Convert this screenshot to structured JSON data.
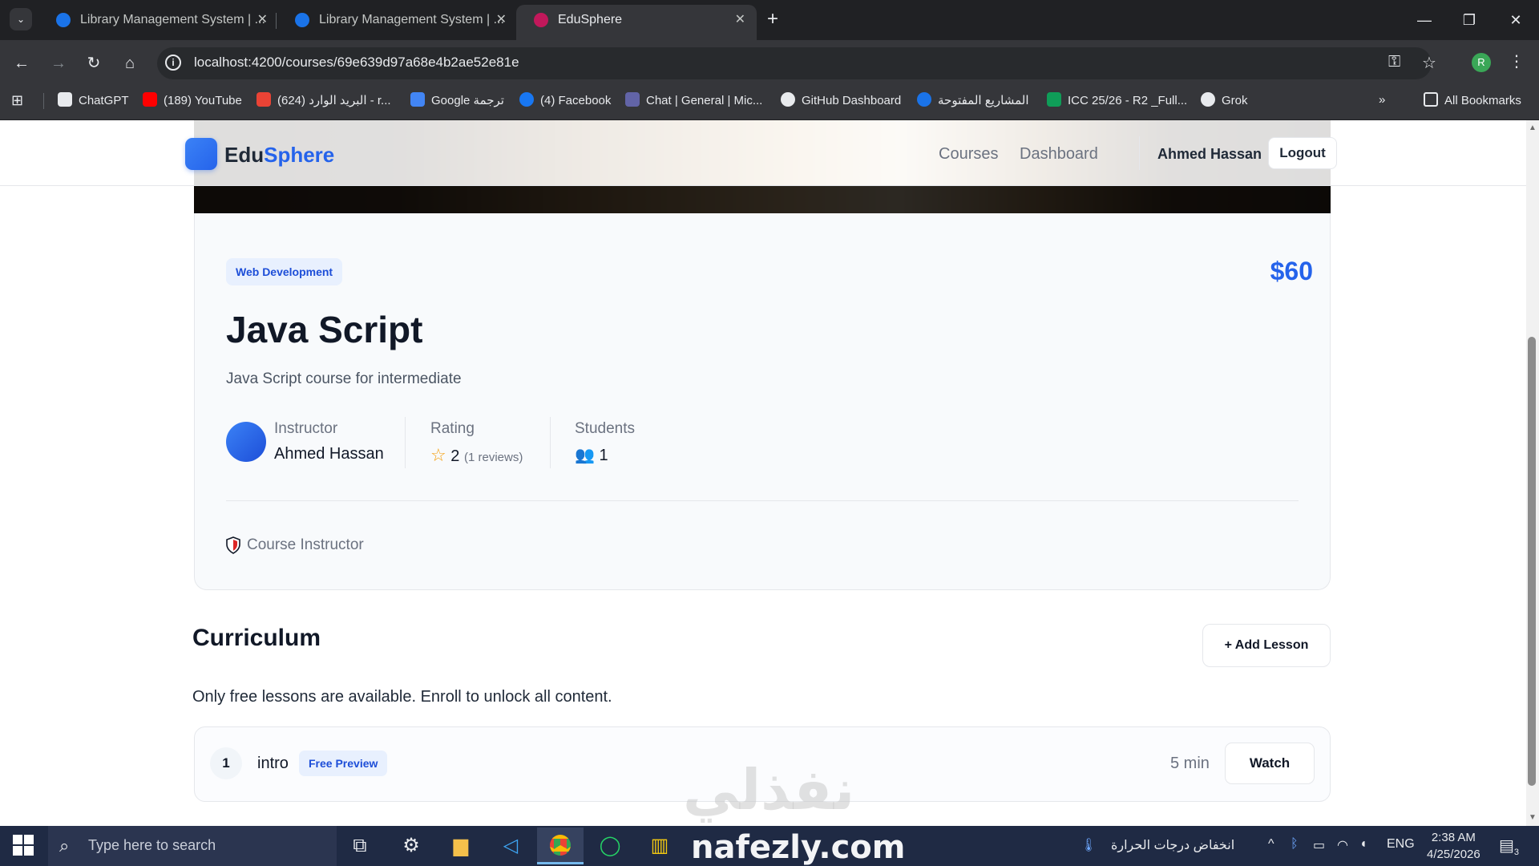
{
  "browser": {
    "tabs": [
      {
        "title": "Library Management System | ...",
        "color": "#1a73e8"
      },
      {
        "title": "Library Management System | ...",
        "color": "#1a73e8"
      },
      {
        "title": "EduSphere",
        "color": "#c2185b"
      }
    ],
    "new_tab": "+",
    "url": "localhost:4200/courses/69e639d97a68e4b2ae52e81e",
    "profile_initial": "R",
    "bookmarks": [
      {
        "label": "ChatGPT",
        "color": "#e8eaed"
      },
      {
        "label": "(189) YouTube",
        "color": "#ff0000"
      },
      {
        "label": "(624) البريد الوارد - r...",
        "color": "#ea4335"
      },
      {
        "label": "Google ترجمة",
        "color": "#4285f4"
      },
      {
        "label": "(4) Facebook",
        "color": "#1877f2"
      },
      {
        "label": "Chat | General | Mic...",
        "color": "#6264a7"
      },
      {
        "label": "GitHub Dashboard",
        "color": "#e8eaed"
      },
      {
        "label": "المشاريع المفتوحة",
        "color": "#1a73e8"
      },
      {
        "label": "ICC 25/26 - R2 _Full...",
        "color": "#0f9d58"
      },
      {
        "label": "Grok",
        "color": "#e8eaed"
      }
    ],
    "all_bookmarks": "All Bookmarks",
    "overflow": "»"
  },
  "navbar": {
    "logo_part1": "Edu",
    "logo_part2": "Sphere",
    "links": [
      "Courses",
      "Dashboard"
    ],
    "user": "Ahmed Hassan",
    "logout": "Logout"
  },
  "course": {
    "category": "Web Development",
    "price": "$60",
    "title": "Java Script",
    "description": "Java Script course for intermediate",
    "instructor_label": "Instructor",
    "instructor_name": "Ahmed Hassan",
    "rating_label": "Rating",
    "rating_value": "2",
    "rating_reviews": "(1 reviews)",
    "students_label": "Students",
    "students_value": "1",
    "role": "Course Instructor"
  },
  "curriculum": {
    "title": "Curriculum",
    "add_lesson": "+ Add Lesson",
    "note": "Only free lessons are available. Enroll to unlock all content.",
    "lessons": [
      {
        "number": "1",
        "title": "intro",
        "badge": "Free Preview",
        "duration": "5 min",
        "action": "Watch"
      }
    ]
  },
  "watermark": {
    "arabic": "نفذلي",
    "latin": "nafezly.com"
  },
  "taskbar": {
    "search_placeholder": "Type here to search",
    "weather_text": "انخفاض درجات الحرارة",
    "language": "ENG",
    "time": "2:38 AM",
    "date": "4/25/2026",
    "notifications": "3"
  }
}
